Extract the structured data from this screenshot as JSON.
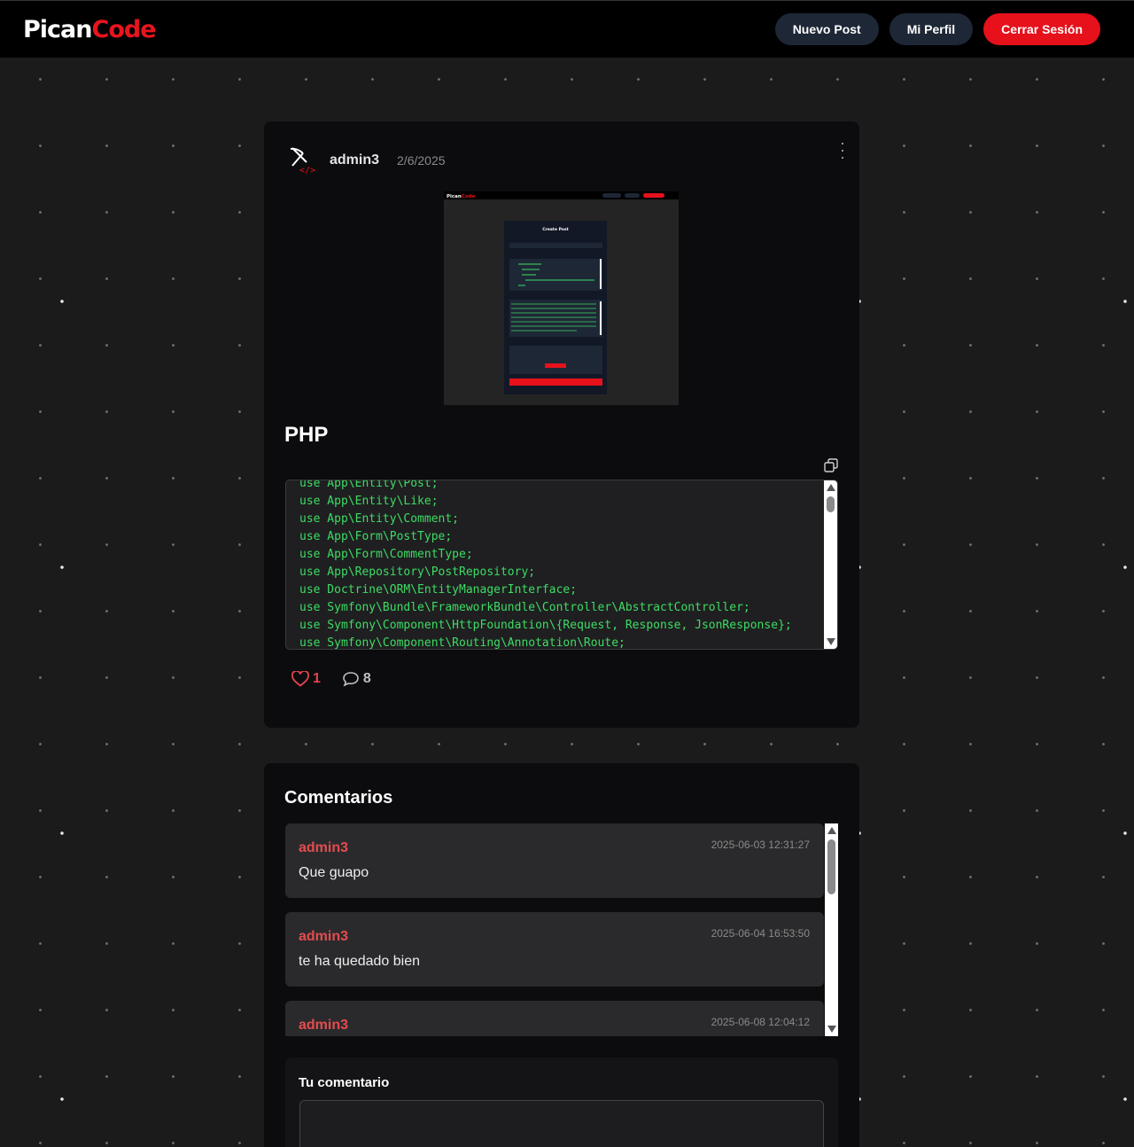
{
  "header": {
    "logo_part1": "Pican",
    "logo_part2": "Code",
    "nav": {
      "new_post": "Nuevo Post",
      "profile": "Mi Perfil",
      "logout": "Cerrar Sesión"
    }
  },
  "post": {
    "author": "admin3",
    "date": "2/6/2025",
    "language": "PHP",
    "code_lines": [
      "use App\\Entity\\Post;",
      "use App\\Entity\\Like;",
      "use App\\Entity\\Comment;",
      "use App\\Form\\PostType;",
      "use App\\Form\\CommentType;",
      "use App\\Repository\\PostRepository;",
      "use Doctrine\\ORM\\EntityManagerInterface;",
      "use Symfony\\Bundle\\FrameworkBundle\\Controller\\AbstractController;",
      "use Symfony\\Component\\HttpFoundation\\{Request, Response, JsonResponse};",
      "use Symfony\\Component\\Routing\\Annotation\\Route;"
    ],
    "likes": "1",
    "comments_count": "8",
    "colors": {
      "code_text": "#3ddc64",
      "like": "#e0454d",
      "accent": "#e6111b"
    }
  },
  "comments": {
    "title": "Comentarios",
    "items": [
      {
        "user": "admin3",
        "date": "2025-06-03 12:31:27",
        "text": "Que guapo"
      },
      {
        "user": "admin3",
        "date": "2025-06-04 16:53:50",
        "text": "te ha quedado bien"
      },
      {
        "user": "admin3",
        "date": "2025-06-08 12:04:12",
        "text": ""
      }
    ],
    "form_label": "Tu comentario",
    "input_value": ""
  }
}
